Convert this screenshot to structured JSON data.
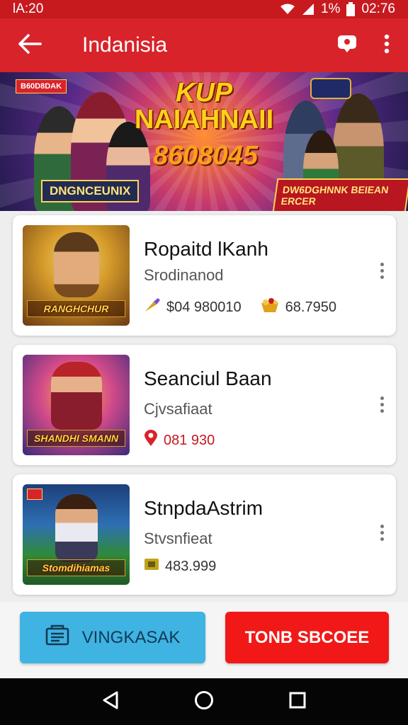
{
  "status_bar": {
    "left_text": "lA:20",
    "battery_text": "1%",
    "time": "02:76"
  },
  "app_bar": {
    "title": "Indanisia",
    "back_icon": "arrow-left-icon",
    "chat_icon": "chat-bubble-icon",
    "more_icon": "more-vertical-icon"
  },
  "banner": {
    "tag": "B60D8DAK",
    "headline_1": "KUP",
    "headline_2": "NAIAHNAII",
    "number": "8608045",
    "left_label": "DNGNCEUNIX",
    "right_label": "DW6DGHNNK BEIEAN ERCER"
  },
  "games": [
    {
      "title": "Ropaitd lKanh",
      "subtitle": "Srodinanod",
      "thumb_label": "RANGHCHUR",
      "meta": [
        {
          "icon": "trophy-icon",
          "value": "$04 980010"
        },
        {
          "icon": "treasure-icon",
          "value": "68.7950"
        }
      ]
    },
    {
      "title": "Seanciul Baan",
      "subtitle": "Cjvsafiaat",
      "thumb_label": "SHANDHI SMANN",
      "meta": [
        {
          "icon": "location-pin-icon",
          "value": "081 930"
        }
      ]
    },
    {
      "title": "StnpdaAstrim",
      "subtitle": "Stvsnfieat",
      "thumb_label": "Stomdihiamas",
      "meta": [
        {
          "icon": "ticket-icon",
          "value": "483.999"
        }
      ]
    }
  ],
  "actions": {
    "primary_label": "VINGKASAK",
    "danger_label": "TONB SBCOEE"
  },
  "colors": {
    "app_bar": "#d9232a",
    "primary_button": "#3fb3e2",
    "danger_button": "#f21818"
  }
}
